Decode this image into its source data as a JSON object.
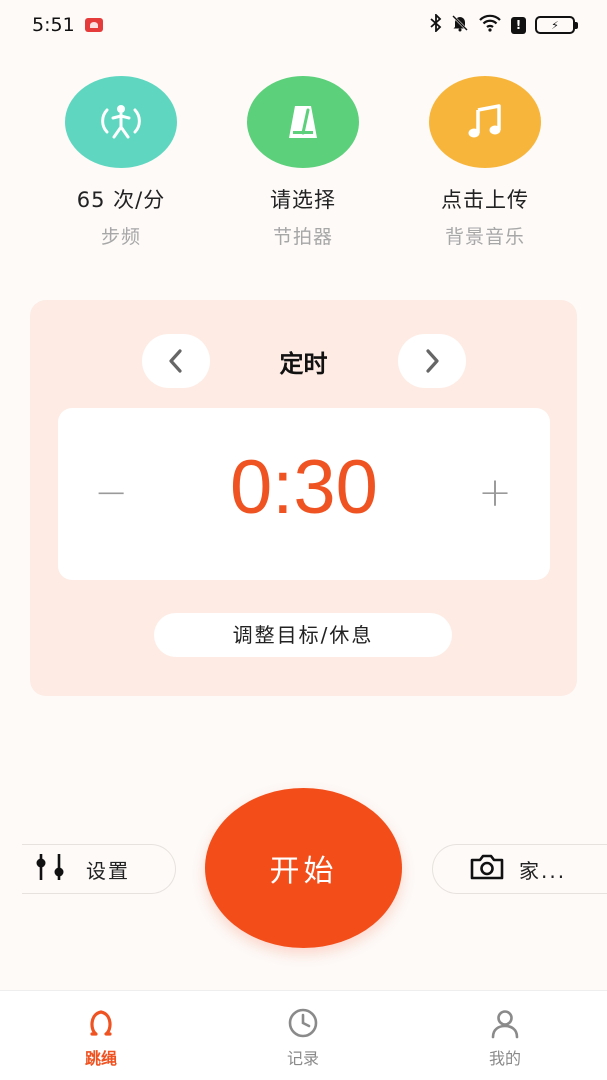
{
  "status_bar": {
    "time": "5:51",
    "battery_label": "⚡"
  },
  "quick_options": [
    {
      "value": "65 次/分",
      "label": "步频",
      "icon": "jump-rope-person-icon",
      "color": "#5fd7c0"
    },
    {
      "value": "请选择",
      "label": "节拍器",
      "icon": "metronome-icon",
      "color": "#5cd07a"
    },
    {
      "value": "点击上传",
      "label": "背景音乐",
      "icon": "music-note-icon",
      "color": "#f7b63b"
    }
  ],
  "timer_card": {
    "mode_title": "定时",
    "time_value": "0:30",
    "minus_symbol": "−",
    "plus_symbol": "+",
    "adjust_label": "调整目标/休息"
  },
  "controls": {
    "settings_label": "设置",
    "start_label": "开始",
    "family_label": "家..."
  },
  "bottom_nav": {
    "tabs": [
      {
        "label": "跳绳",
        "icon": "jump-rope-icon",
        "active": true
      },
      {
        "label": "记录",
        "icon": "clock-icon",
        "active": false
      },
      {
        "label": "我的",
        "icon": "profile-icon",
        "active": false
      }
    ]
  },
  "colors": {
    "accent": "#f05322",
    "start_button": "#f34d1a",
    "card_bg": "#fdebe4"
  }
}
